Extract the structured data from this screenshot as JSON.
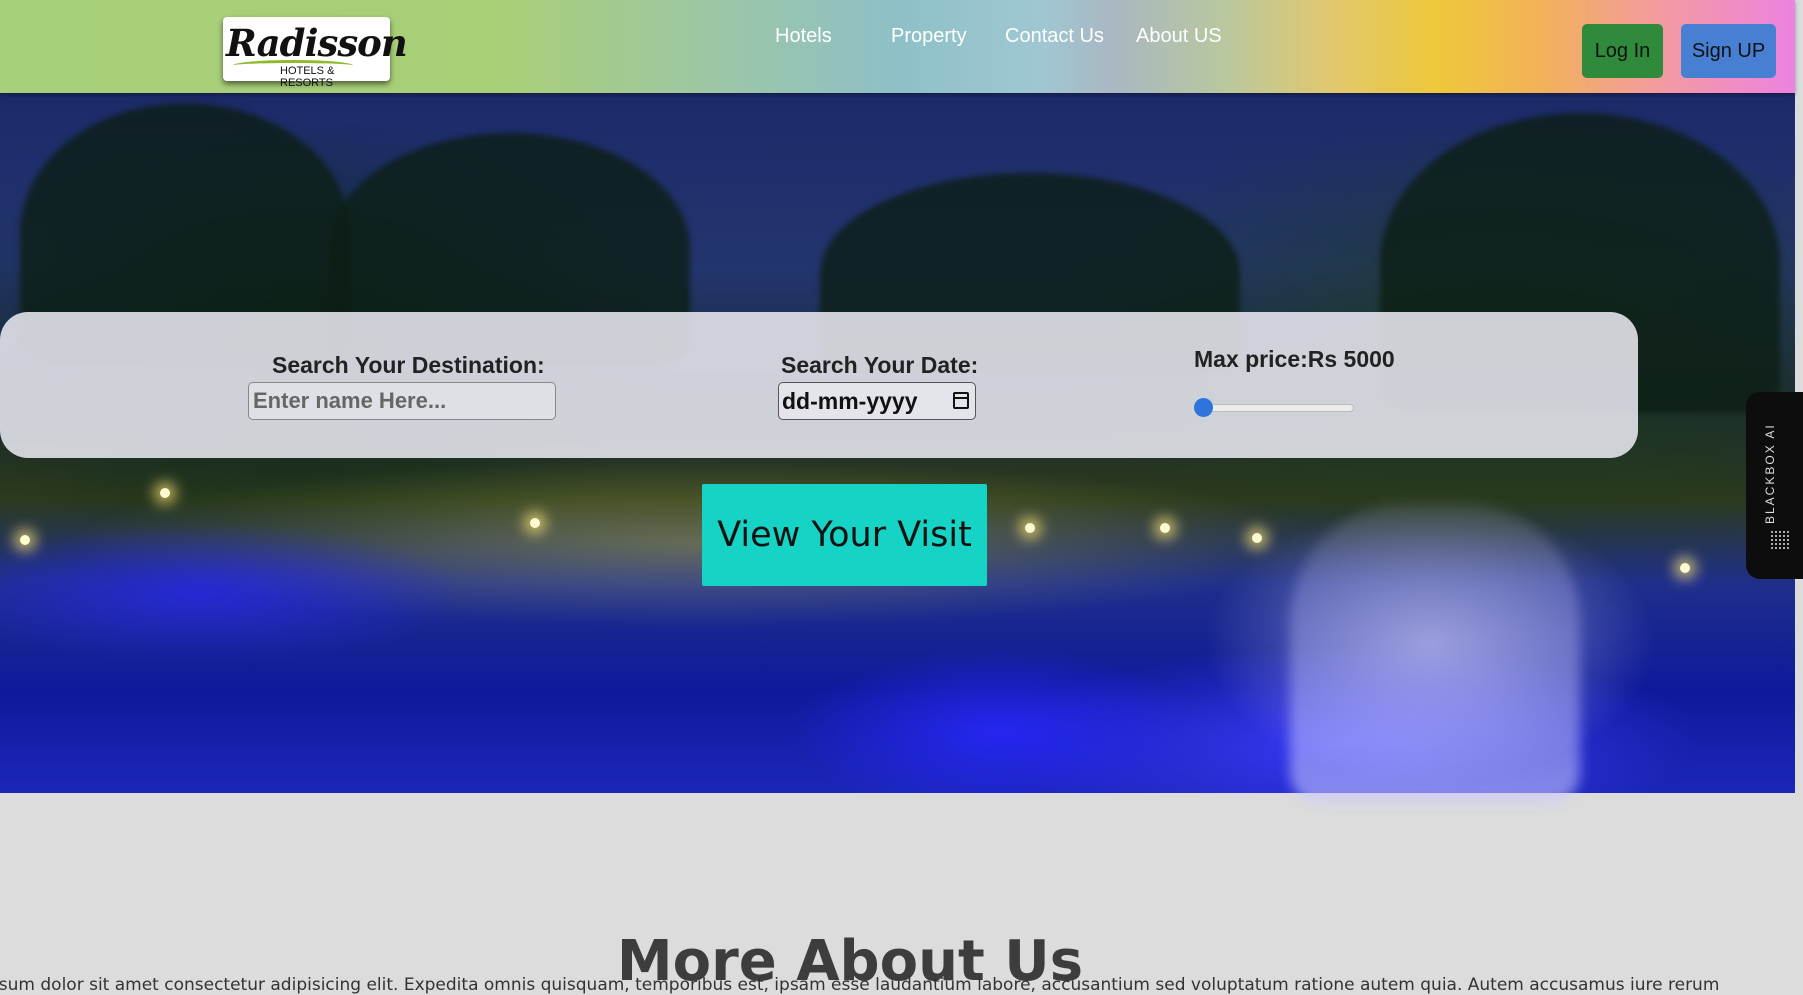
{
  "navbar": {
    "logo_text": "Radisson",
    "logo_subtext": "HOTELS & RESORTS",
    "links": [
      "Hotels",
      "Property",
      "Contact Us",
      "About US"
    ],
    "login_label": "Log In",
    "signup_label": "Sign UP"
  },
  "search": {
    "destination_label": "Search Your Destination:",
    "destination_placeholder": "Enter name Here...",
    "date_label": "Search Your Date:",
    "date_placeholder": "dd-mm-yyyy",
    "price_label": "Max price:Rs 5000",
    "price_slider_position": 0
  },
  "cta_label": "View Your Visit",
  "side_tab_label": "BLACKBOX AI",
  "about": {
    "title": "More About Us",
    "paragraph": "psum dolor sit amet consectetur adipisicing elit. Expedita omnis quisquam, temporibus est, ipsam esse laudantium labore, accusantium sed voluptatum ratione autem quia. Autem accusamus iure rerum"
  },
  "colors": {
    "login_button": "#2f8a3c",
    "signup_button": "#4780d3",
    "cta_button": "#15d3c5",
    "slider_thumb": "#2f74dd"
  }
}
